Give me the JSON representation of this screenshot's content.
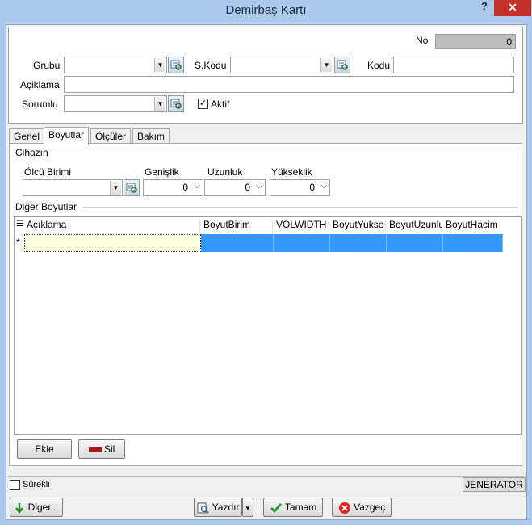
{
  "window": {
    "title": "Demirbaş Kartı",
    "help": "?",
    "close": "✕"
  },
  "header": {
    "no_label": "No",
    "no_value": "0",
    "grubu_label": "Grubu",
    "skodu_label": "S.Kodu",
    "kodu_label": "Kodu",
    "aciklama_label": "Açiklama",
    "sorumlu_label": "Sorumlu",
    "aktif_label": "Aktif",
    "aktif_checked": true
  },
  "tabs": [
    {
      "label": "Genel",
      "active": false
    },
    {
      "label": "Boyutlar",
      "active": true
    },
    {
      "label": "Ölçüler",
      "active": false
    },
    {
      "label": "Bakım",
      "active": false
    }
  ],
  "boyutlar": {
    "cihazin_title": "Cihazın",
    "olcu_birimi_label": "Ölcü Birimi",
    "genislik_label": "Genişlik",
    "genislik_value": "0",
    "uzunluk_label": "Uzunluk",
    "uzunluk_value": "0",
    "yukseklik_label": "Yükseklik",
    "yukseklik_value": "0",
    "diger_title": "Diğer Boyutlar",
    "grid": {
      "columns": [
        "Açıklama",
        "BoyutBirim",
        "VOLWIDTH",
        "BoyutYukse",
        "BoyutUzunlu",
        "BoyutHacim"
      ],
      "new_row_marker": "*"
    },
    "ekle_label": "Ekle",
    "sil_label": "Sil"
  },
  "status": {
    "surekli_label": "Sürekli",
    "jenerator_label": "JENERATOR"
  },
  "footer": {
    "diger_label": "Diger...",
    "yazdir_label": "Yazdır",
    "tamam_label": "Tamam",
    "vazgec_label": "Vazgeç"
  },
  "colors": {
    "title_bar": "#acc9ec",
    "close": "#c7302a",
    "selection": "#3399ff",
    "current_cell": "#ffffe1"
  }
}
